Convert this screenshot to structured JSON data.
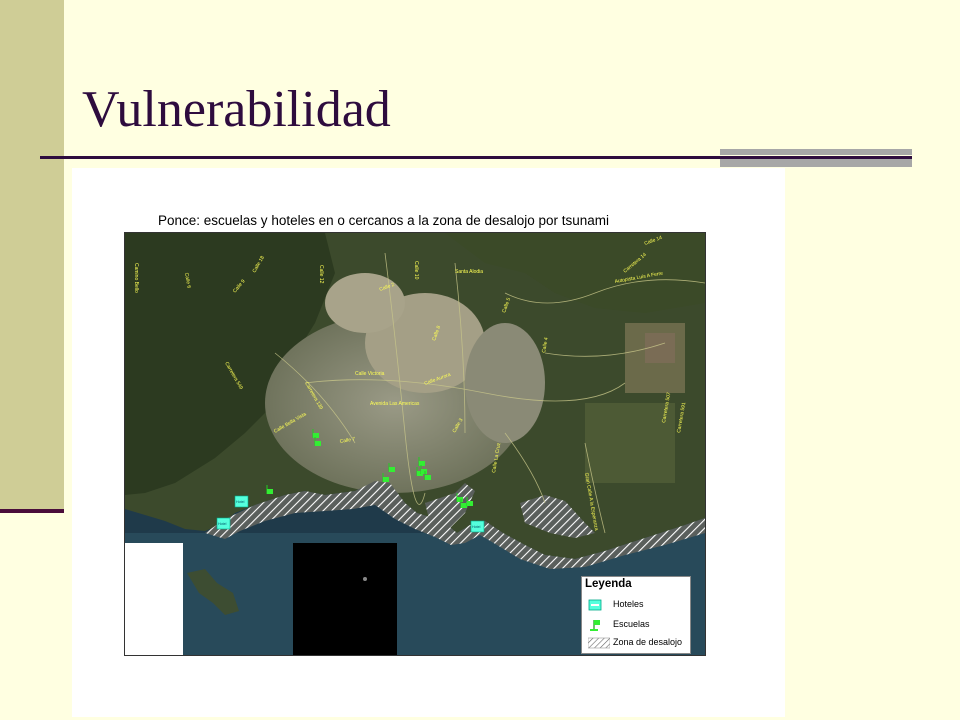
{
  "slide": {
    "title": "Vulnerabilidad"
  },
  "map": {
    "title": "Ponce: escuelas y hoteles en o cercanos a la zona de desalojo por tsunami",
    "road_labels": [
      "Camino Bello",
      "Calle 6",
      "Calle 18",
      "Calle 12",
      "Calle 9",
      "Calle 2",
      "Carretera 549",
      "Carretera 139",
      "Calle Victoria",
      "Calle Aurora",
      "Avenida Las Americas",
      "Calle 8",
      "Calle 10",
      "Calle 14",
      "Carretera 14",
      "Carretera 507",
      "Carretera 591",
      "Calle La Cruz",
      "Calle 3",
      "Calle 4",
      "Calle 5",
      "Calle 7",
      "Gran Calle A la Esperanza",
      "Calle Bella Vista",
      "Autopista Luis A Ferre",
      "Santa Alodia"
    ],
    "hotels": [
      "Hotel",
      "Hotel",
      "Hotel"
    ],
    "colors": {
      "hotel": "#55ffdd",
      "school": "#33ee33",
      "roads": "#ffff55",
      "zone_hatch": "#ffffff"
    }
  },
  "legend": {
    "title": "Leyenda",
    "items": [
      {
        "label": "Hoteles",
        "icon": "hotel-icon"
      },
      {
        "label": "Escuelas",
        "icon": "school-flag-icon"
      },
      {
        "label": "Zona de desalojo",
        "icon": "hatch-icon"
      }
    ]
  }
}
